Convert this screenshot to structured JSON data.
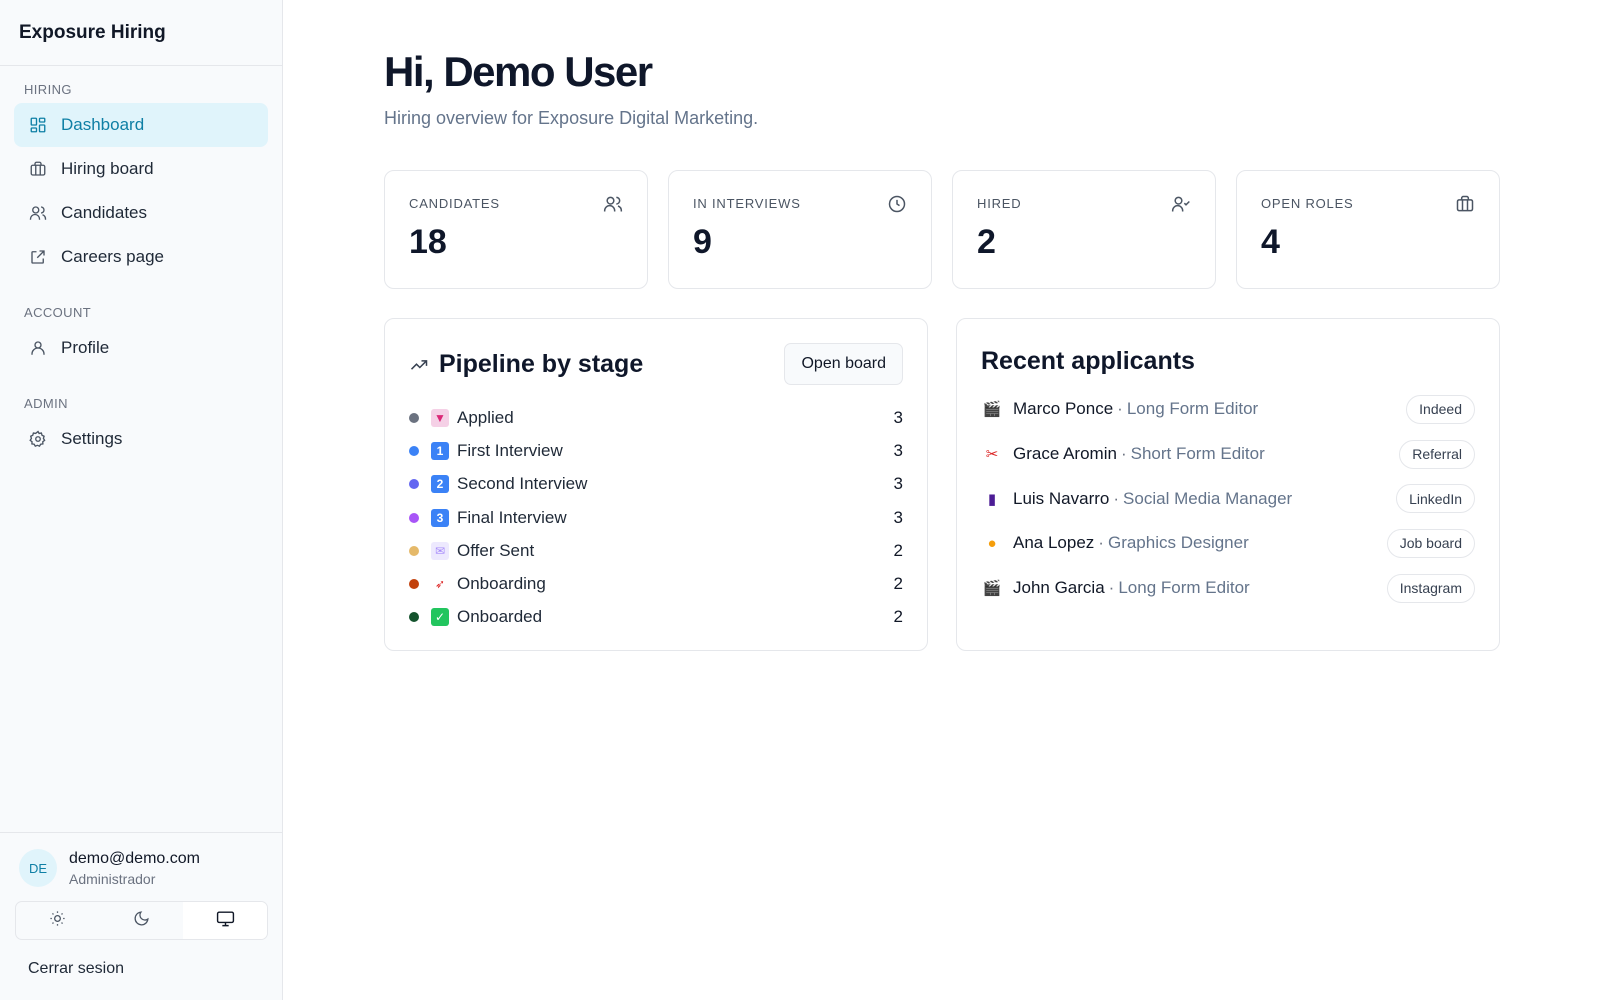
{
  "sidebar": {
    "brand": "Exposure Hiring",
    "sections": [
      {
        "title": "HIRING",
        "items": [
          {
            "label": "Dashboard",
            "icon": "dashboard-icon",
            "active": true
          },
          {
            "label": "Hiring board",
            "icon": "briefcase-icon"
          },
          {
            "label": "Candidates",
            "icon": "users-icon"
          },
          {
            "label": "Careers page",
            "icon": "external-link-icon"
          }
        ]
      },
      {
        "title": "ACCOUNT",
        "items": [
          {
            "label": "Profile",
            "icon": "user-icon"
          }
        ]
      },
      {
        "title": "ADMIN",
        "items": [
          {
            "label": "Settings",
            "icon": "gear-icon"
          }
        ]
      }
    ],
    "user": {
      "initials": "DE",
      "email": "demo@demo.com",
      "role": "Administrador"
    },
    "theme": {
      "options": [
        "sun-icon",
        "moon-icon",
        "monitor-icon"
      ],
      "selected": "monitor-icon"
    },
    "logout_label": "Cerrar sesion"
  },
  "header": {
    "title": "Hi, Demo User",
    "subtitle": "Hiring overview for Exposure Digital Marketing."
  },
  "stats": [
    {
      "label": "CANDIDATES",
      "value": "18",
      "icon": "users-icon"
    },
    {
      "label": "IN INTERVIEWS",
      "value": "9",
      "icon": "clock-icon"
    },
    {
      "label": "HIRED",
      "value": "2",
      "icon": "user-check-icon"
    },
    {
      "label": "OPEN ROLES",
      "value": "4",
      "icon": "briefcase-icon"
    }
  ],
  "pipeline": {
    "title": "Pipeline by stage",
    "open_board_label": "Open board",
    "stages": [
      {
        "name": "Applied",
        "count": "3",
        "dot_color": "#6b7280",
        "emoji": "inbox-tray-emoji"
      },
      {
        "name": "First Interview",
        "count": "3",
        "dot_color": "#3b82f6",
        "emoji": "keycap-1-emoji",
        "glyph": "1"
      },
      {
        "name": "Second Interview",
        "count": "3",
        "dot_color": "#6366f1",
        "emoji": "keycap-2-emoji",
        "glyph": "2"
      },
      {
        "name": "Final Interview",
        "count": "3",
        "dot_color": "#a855f7",
        "emoji": "keycap-3-emoji",
        "glyph": "3"
      },
      {
        "name": "Offer Sent",
        "count": "2",
        "dot_color": "#e5b96a",
        "emoji": "envelope-emoji"
      },
      {
        "name": "Onboarding",
        "count": "2",
        "dot_color": "#c2410c",
        "emoji": "rocket-emoji"
      },
      {
        "name": "Onboarded",
        "count": "2",
        "dot_color": "#14532d",
        "emoji": "check-mark-emoji"
      }
    ]
  },
  "recent": {
    "title": "Recent applicants",
    "applicants": [
      {
        "name": "Marco Ponce",
        "role": "Long Form Editor",
        "source": "Indeed",
        "emoji": "clapper-emoji"
      },
      {
        "name": "Grace Aromin",
        "role": "Short Form Editor",
        "source": "Referral",
        "emoji": "scissors-emoji"
      },
      {
        "name": "Luis Navarro",
        "role": "Social Media Manager",
        "source": "LinkedIn",
        "emoji": "phone-emoji"
      },
      {
        "name": "Ana Lopez",
        "role": "Graphics Designer",
        "source": "Job board",
        "emoji": "palette-emoji"
      },
      {
        "name": "John Garcia",
        "role": "Long Form Editor",
        "source": "Instagram",
        "emoji": "clapper-emoji"
      }
    ]
  }
}
